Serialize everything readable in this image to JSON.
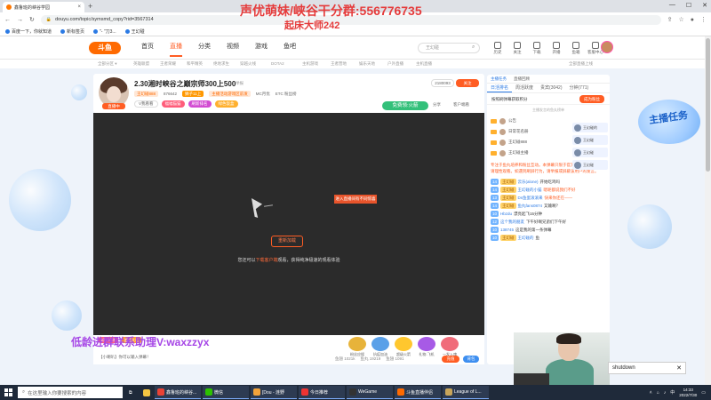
{
  "browser": {
    "tab_title": "鑫鲁班的峡谷学园",
    "tab_close": "×",
    "new_tab": "+",
    "window_controls": [
      "—",
      "☐",
      "✕"
    ],
    "url": "douyu.com/topic/symsmd_copy?rid=3567314",
    "bookmarks": [
      "百度一下，你就知道",
      "新标签页",
      "\"- \"刀3...",
      "王幻碰"
    ]
  },
  "site": {
    "logo_text": "斗鱼",
    "nav": [
      "首页",
      "直播",
      "分类",
      "视频",
      "游戏",
      "鱼吧"
    ],
    "active_nav": "直播",
    "search_placeholder": "王幻碰",
    "header_icons": [
      "历史",
      "关注",
      "下载",
      "开播",
      "鱼箱",
      "客服中心"
    ],
    "sub_links": [
      "全部分区 ▾",
      "英雄联盟",
      "王者荣耀",
      "和平精英",
      "绝地求生",
      "穿越火线",
      "DOTA2",
      "主机游戏",
      "王者营地",
      "娱乐天地",
      "户外直播",
      "主机直播",
      "全部直播上线"
    ]
  },
  "overlay": {
    "top": "声优萌妹/峡谷干分群:556776735",
    "sub": "起床大师242",
    "bottom": "低龄进群联系助理V:waxzzyx"
  },
  "stream": {
    "title": "2.30湘时峡谷之巅宗师300上500",
    "report": "举报",
    "live_label": "直播中",
    "streamer": "王幻碰",
    "meta": [
      "王幻碰888",
      "876642",
      "狮子11上",
      "主播活动游戏区前发",
      "MC月优",
      "ETC 粉丝榜"
    ],
    "tags": [
      "V我看看",
      "福福猫猫",
      "刷新排名",
      "绿色饭盒"
    ],
    "follow_count": "2180093",
    "follow_btn": "关注",
    "free_gift": "免费领:火箭",
    "share": "分享",
    "client": "客户端看",
    "video_notice": "进入直播间有不同惊喜",
    "resume_btn": "重新加载",
    "video_tip_a": "您还可以",
    "video_tip_hl": "下载客户端",
    "video_tip_b": "观看，获得纯净极速的观看体验"
  },
  "bottom": {
    "badges": [
      "粉丝打赏",
      "超级大礼"
    ],
    "gifts": [
      "粉丝应援",
      "抗疫加油",
      "超级火箭",
      "礼物-飞机",
      "一发入魂"
    ],
    "row2": "【小喇叭】你可以输入弹幕！",
    "stats": [
      "鱼翅 1021k",
      "鱼丸 19219",
      "鱼翅 1091"
    ],
    "recharge": "充值",
    "backpack": "背包"
  },
  "chat": {
    "tabs": [
      "日活排名",
      "周活跃度",
      "贵宾(3042)",
      "分钟(771)"
    ],
    "sub_tabs": [
      "主播任务",
      "直播回顾"
    ],
    "fans_label": "按照刷弹幕获取积分",
    "fans_btn": "成为粉丝",
    "rank_hint": "主播发言的鱼丸榜单",
    "rank": [
      "公告",
      "日常花名册",
      "王幻碰888",
      "王幻碰主播"
    ],
    "system_notice": "专注于鱼丸培养和粉丝互动。本弹幕只限于官方发布的信息类，请理性观看。如遇到刷屏行为，请举报或屏蔽该用户的发言。",
    "messages": [
      {
        "lv": "14",
        "fan": "王幻碰",
        "nick": "云乐(alone)",
        "text": "开始吃鸡吗"
      },
      {
        "lv": "14",
        "fan": "王幻碰",
        "nick": "王幻碰的小猫",
        "text": "嗯呢都说我们不好",
        "hot": true
      },
      {
        "lv": "13",
        "fan": "王幻碰",
        "nick": "Ds鱼蛋滚滚来",
        "text": "快来你还在——",
        "hot": true
      },
      {
        "lv": "14",
        "fan": "王幻碰",
        "nick": "鱼丸fans0874",
        "text": "又输啊？"
      },
      {
        "lv": "10",
        "fan": "",
        "nick": "Hbzdu",
        "text": "漂亮起飞15分钟"
      },
      {
        "lv": "12",
        "fan": "",
        "nick": "这个我的朋友",
        "text": "下午好啊兄弟们下午好"
      },
      {
        "lv": "10",
        "fan": "",
        "nick": "138745",
        "text": "这是我的第一条弹幕"
      },
      {
        "lv": "10",
        "fan": "王幻碰",
        "nick": "王幻碰的",
        "text": "鱼"
      }
    ],
    "guards": [
      "王幻碰的",
      "王幻碰",
      "王幻碰",
      "王幻碰"
    ]
  },
  "promo": {
    "text": "主播任务"
  },
  "popup": {
    "text": "shutdown",
    "close": "✕"
  },
  "taskbar": {
    "search_placeholder": "在这里输入你要搜索的内容",
    "apps": [
      "鑫鲁班的峡谷...",
      "微信",
      "[Dou - 涟野",
      "今日推荐",
      "WeGame",
      "斗鱼直播伴侣",
      "League of L..."
    ],
    "tray_lang": "中",
    "time": "14:33",
    "date": "2022/7/30"
  },
  "colors": {
    "accent": "#ff5d23",
    "brand_blue": "#2b7ae4",
    "overlay_red": "#e53b3b",
    "overlay_purple": "#a646e6"
  }
}
